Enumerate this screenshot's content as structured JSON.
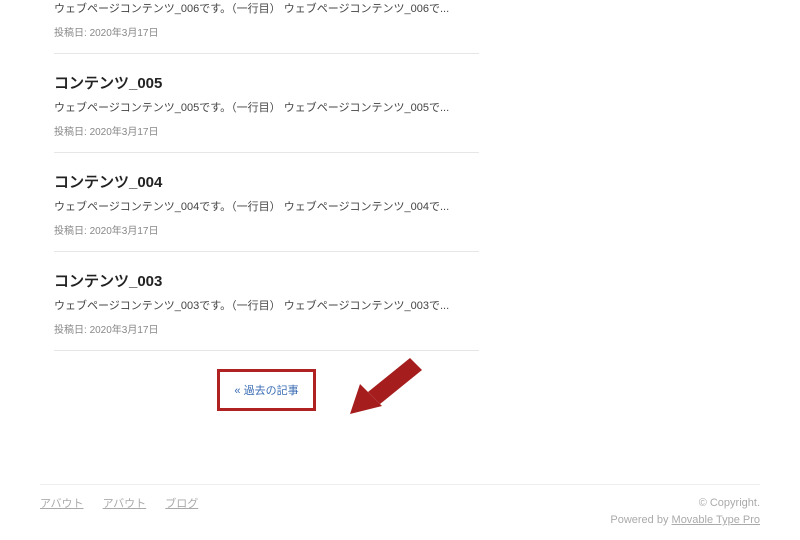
{
  "entries": [
    {
      "title": "",
      "excerpt": "ウェブページコンテンツ_006です。（一行目） ウェブページコンテンツ_006で...",
      "meta_label": "投稿日:",
      "date": "2020年3月17日"
    },
    {
      "title": "コンテンツ_005",
      "excerpt": "ウェブページコンテンツ_005です。（一行目） ウェブページコンテンツ_005で...",
      "meta_label": "投稿日:",
      "date": "2020年3月17日"
    },
    {
      "title": "コンテンツ_004",
      "excerpt": "ウェブページコンテンツ_004です。（一行目） ウェブページコンテンツ_004で...",
      "meta_label": "投稿日:",
      "date": "2020年3月17日"
    },
    {
      "title": "コンテンツ_003",
      "excerpt": "ウェブページコンテンツ_003です。（一行目） ウェブページコンテンツ_003で...",
      "meta_label": "投稿日:",
      "date": "2020年3月17日"
    }
  ],
  "pager": {
    "older_label": "« 過去の記事"
  },
  "footer": {
    "links": [
      "アバウト",
      "アバウト",
      "ブログ"
    ],
    "copyright": "© Copyright.",
    "powered_prefix": "Powered by ",
    "powered_link": "Movable Type Pro"
  },
  "annotation": {
    "arrow_color": "#b02121",
    "box_color": "#b02121"
  }
}
